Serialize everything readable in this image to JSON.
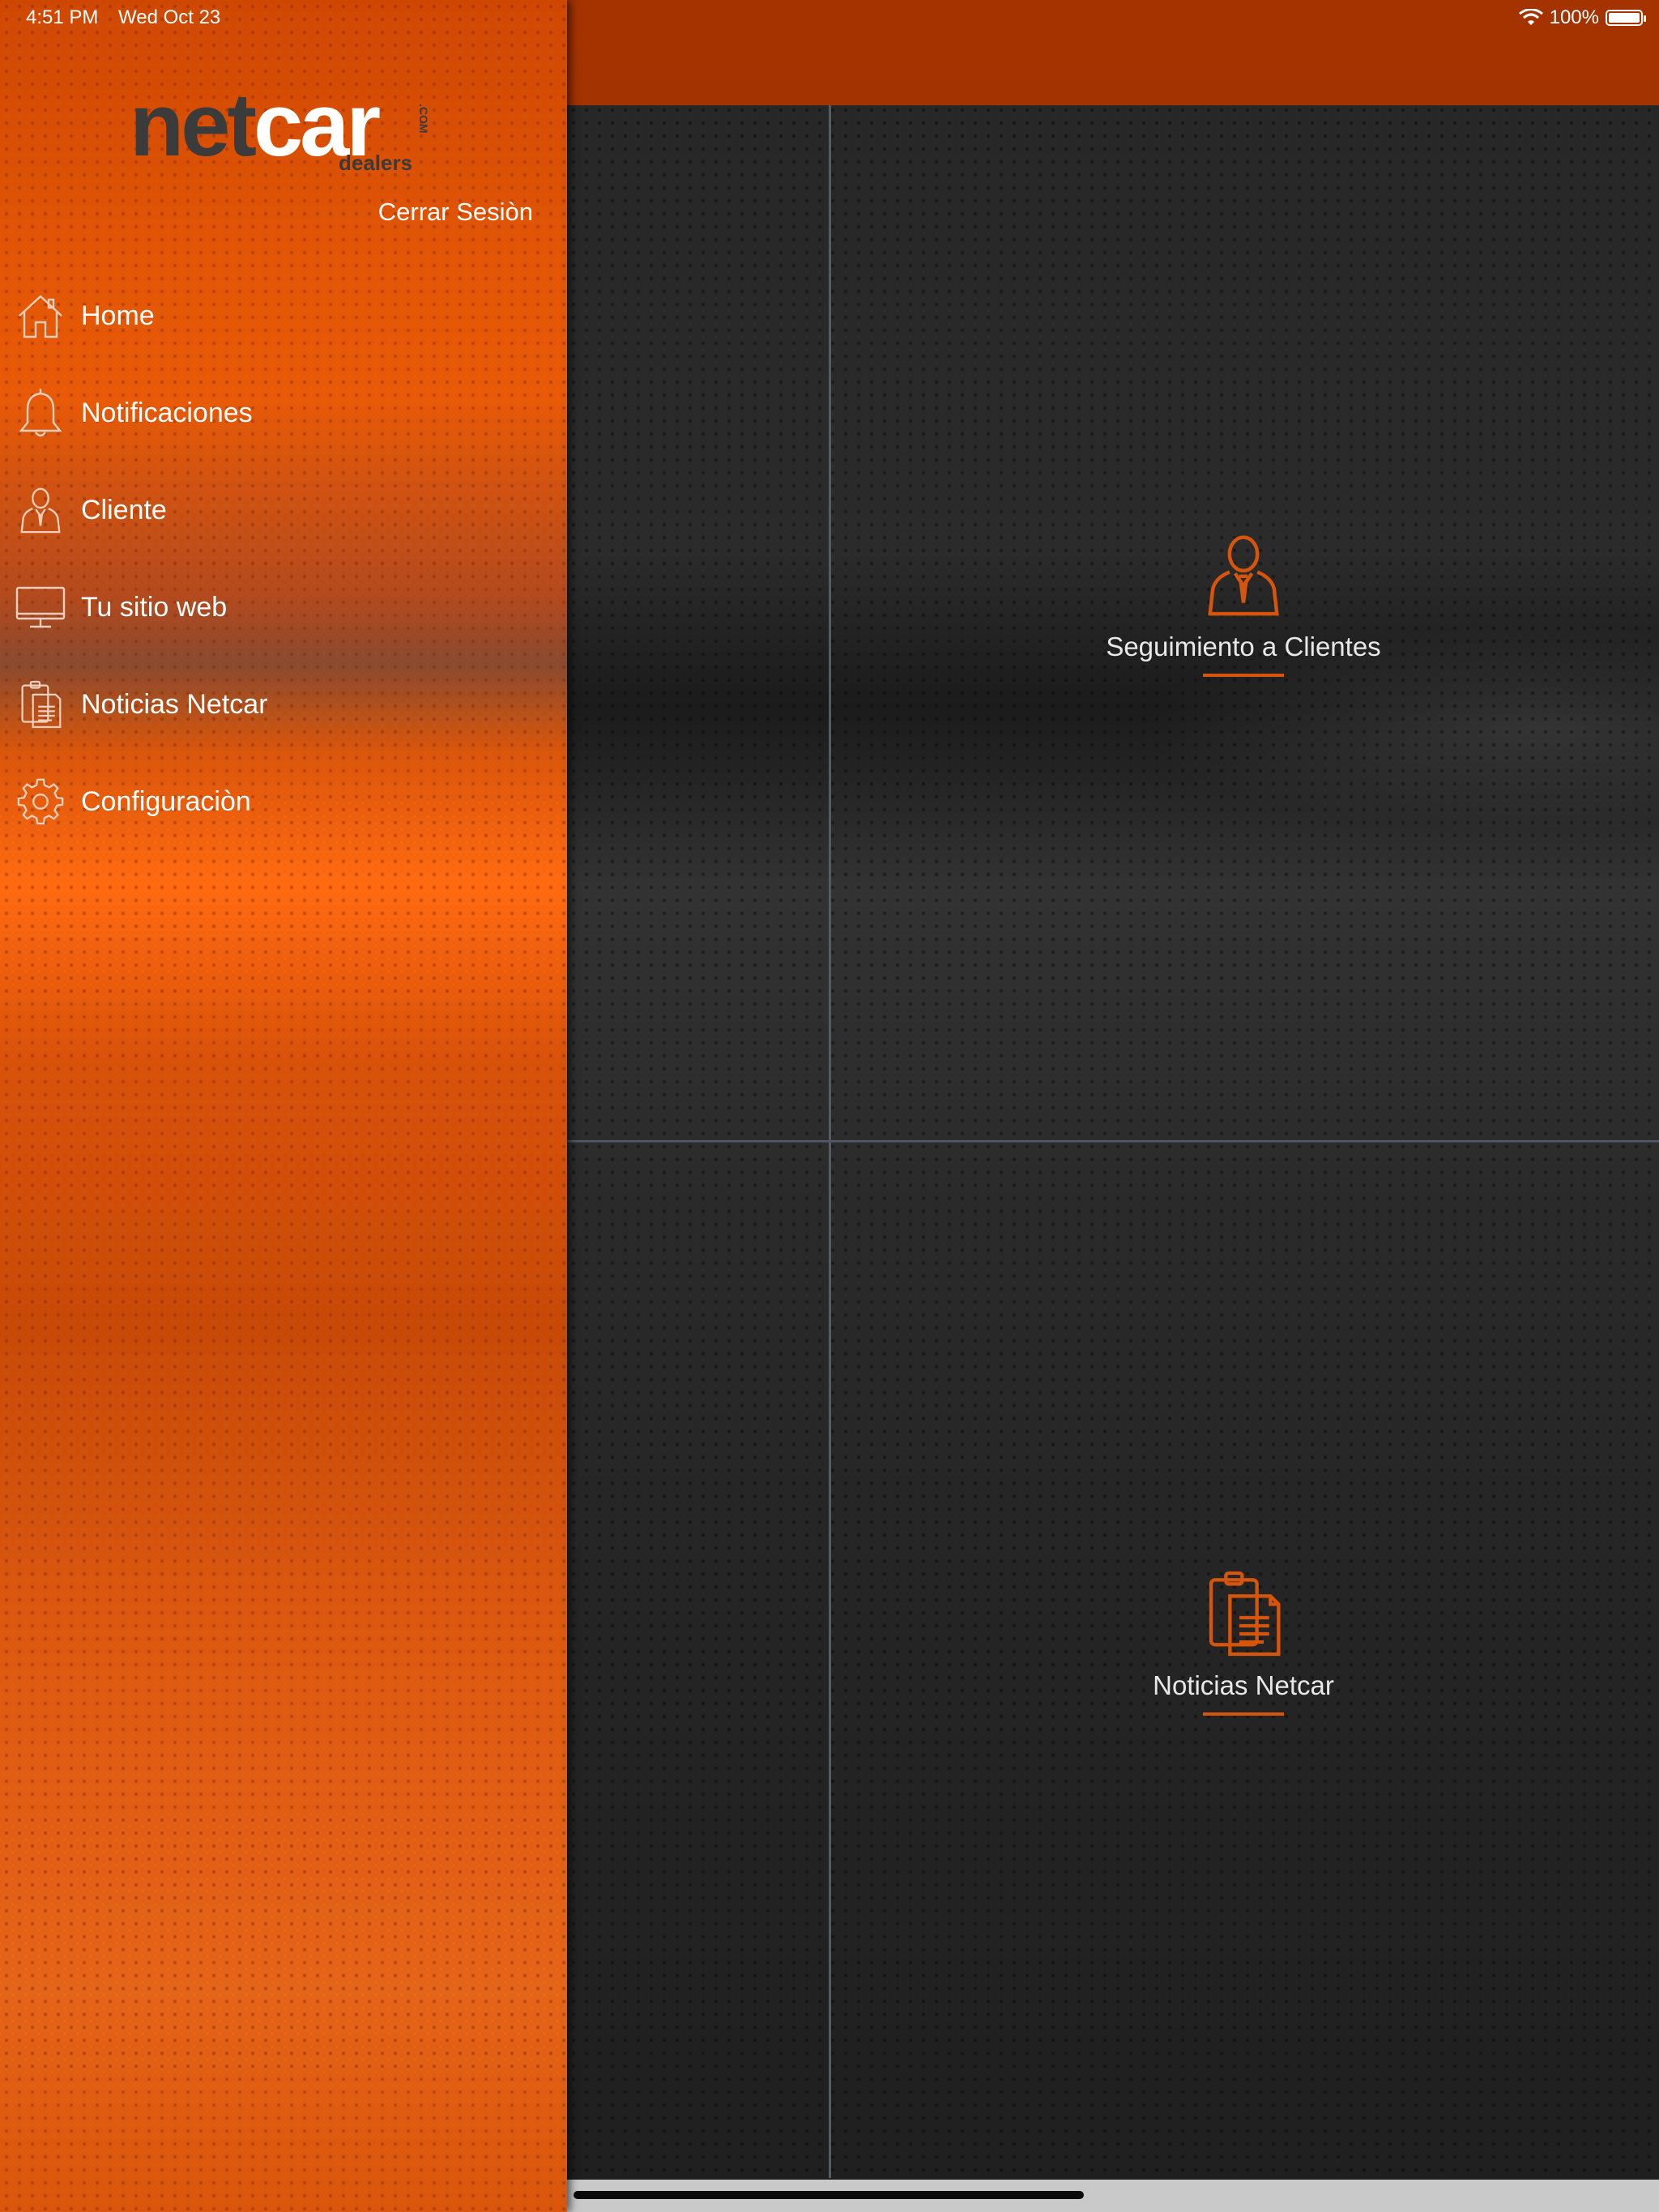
{
  "status_bar": {
    "time": "4:51 PM",
    "date": "Wed Oct 23",
    "battery": "100%"
  },
  "sidebar": {
    "logo": {
      "text_net": "net",
      "text_car": "car",
      "text_com": ".COM",
      "text_dealers": "dealers"
    },
    "logout_label": "Cerrar Sesiòn",
    "items": [
      {
        "label": "Home",
        "icon": "home-icon"
      },
      {
        "label": "Notificaciones",
        "icon": "bell-icon"
      },
      {
        "label": "Cliente",
        "icon": "client-icon"
      },
      {
        "label": "Tu sitio web",
        "icon": "monitor-icon"
      },
      {
        "label": "Noticias Netcar",
        "icon": "clipboard-icon"
      },
      {
        "label": "Configuraciòn",
        "icon": "gear-icon"
      }
    ]
  },
  "main": {
    "tiles": [
      {
        "label": "Seguimiento a Clientes",
        "icon": "client-icon"
      },
      {
        "label": "Noticias Netcar",
        "icon": "clipboard-icon"
      }
    ]
  },
  "colors": {
    "accent": "#d4550b",
    "topbar": "#a43300",
    "sidebar": "#e85a07"
  }
}
